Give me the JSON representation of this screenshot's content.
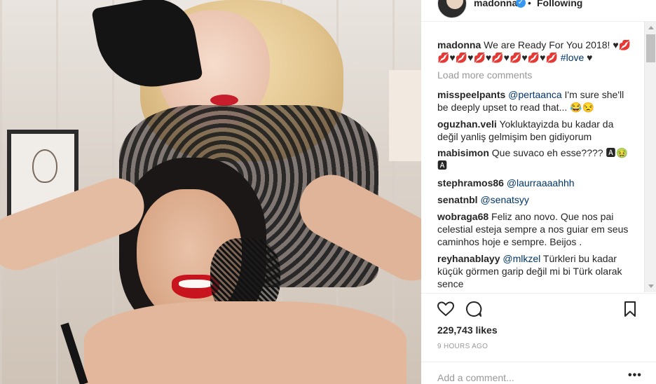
{
  "post": {
    "username": "madonna",
    "follow_status": "Following",
    "separator": "•",
    "verified_mark": "✓",
    "caption_user": "madonna",
    "caption_text": "We are Ready For You 2018! ♥💋",
    "caption_line2": "💋♥💋♥💋♥💋♥💋♥💋♥💋",
    "caption_tag": "#love",
    "caption_end": "♥"
  },
  "load_more": "Load more comments",
  "comments": [
    {
      "user": "misspeelpants",
      "mention": "@pertaanca",
      "text": " I'm sure she'll be deeply upset to read that... 😂😒"
    },
    {
      "user": "oguzhan.veli",
      "mention": "",
      "text": "Yokluktayizda bu kadar da değil yanliş gelmişim ben gidiyorum"
    },
    {
      "user": "mabisimon",
      "mention": "",
      "text": "Que suvaco eh esse???? 🅰🤢 🅰"
    },
    {
      "user": "stephramos86",
      "mention": "@laurraaaahhh",
      "text": ""
    },
    {
      "user": "senatnbl",
      "mention": "@senatsyy",
      "text": ""
    },
    {
      "user": "wobraga68",
      "mention": "",
      "text": "Feliz ano novo. Que nos pai celestial esteja sempre a nos guiar em seus caminhos hoje e sempre. Beijos ."
    },
    {
      "user": "reyhanablayy",
      "mention": "@mlkzel",
      "text": " Türkleri bu kadar küçük görmen garip değil mi bi Türk olarak sence"
    }
  ],
  "icons": {
    "like": "heart-icon",
    "comment": "comment-icon",
    "save": "bookmark-icon",
    "verified": "verified-badge-icon",
    "more": "more-options-icon"
  },
  "likes": "229,743 likes",
  "timestamp": "9 HOURS AGO",
  "add_comment_placeholder": "Add a comment...",
  "more_options": "•••",
  "colors": {
    "link": "#003569",
    "muted": "#999999",
    "verified": "#3897f0"
  }
}
